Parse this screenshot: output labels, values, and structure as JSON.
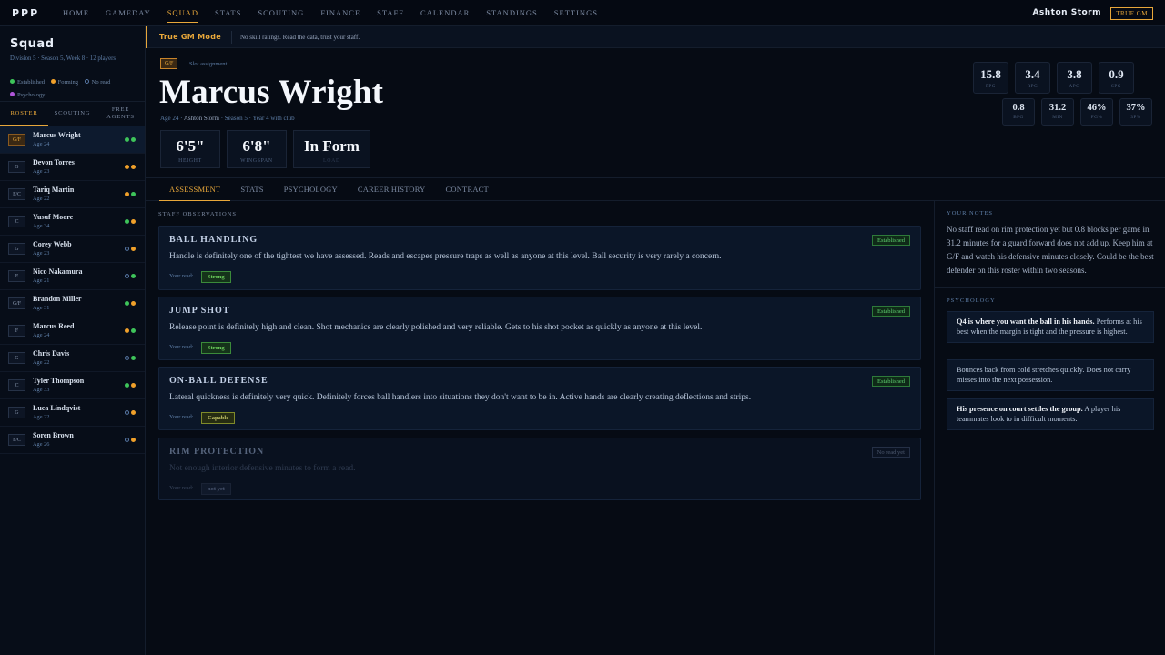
{
  "nav": {
    "logo": "PPP",
    "items": [
      "HOME",
      "GAMEDAY",
      "SQUAD",
      "STATS",
      "SCOUTING",
      "FINANCE",
      "STAFF",
      "CALENDAR",
      "STANDINGS",
      "SETTINGS"
    ],
    "active": "SQUAD",
    "user": "Ashton Storm",
    "mode_badge": "TRUE GM"
  },
  "sidebar": {
    "title": "Squad",
    "subtitle": "Division 5 · Season 5, Week 8 · 12 players",
    "legend": [
      "Established",
      "Forming",
      "No read",
      "Psychology"
    ],
    "tabs": [
      "ROSTER",
      "SCOUTING",
      "FREE AGENTS"
    ],
    "players": [
      {
        "pos": "G/F",
        "name": "Marcus Wright",
        "age": "Age 24",
        "dots": [
          "green",
          "green"
        ]
      },
      {
        "pos": "G",
        "name": "Devon Torres",
        "age": "Age 23",
        "dots": [
          "orange",
          "orange"
        ]
      },
      {
        "pos": "F/C",
        "name": "Tariq Martin",
        "age": "Age 22",
        "dots": [
          "orange",
          "green"
        ]
      },
      {
        "pos": "C",
        "name": "Yusuf Moore",
        "age": "Age 34",
        "dots": [
          "green",
          "orange"
        ]
      },
      {
        "pos": "G",
        "name": "Corey Webb",
        "age": "Age 23",
        "dots": [
          "empty",
          "orange"
        ]
      },
      {
        "pos": "F",
        "name": "Nico Nakamura",
        "age": "Age 21",
        "dots": [
          "empty",
          "green"
        ]
      },
      {
        "pos": "G/F",
        "name": "Brandon Miller",
        "age": "Age 31",
        "dots": [
          "green",
          "orange"
        ]
      },
      {
        "pos": "F",
        "name": "Marcus Reed",
        "age": "Age 24",
        "dots": [
          "orange",
          "green"
        ]
      },
      {
        "pos": "G",
        "name": "Chris Davis",
        "age": "Age 22",
        "dots": [
          "empty",
          "green"
        ]
      },
      {
        "pos": "C",
        "name": "Tyler Thompson",
        "age": "Age 33",
        "dots": [
          "green",
          "orange"
        ]
      },
      {
        "pos": "G",
        "name": "Luca Lindqvist",
        "age": "Age 22",
        "dots": [
          "empty",
          "orange"
        ]
      },
      {
        "pos": "F/C",
        "name": "Soren Brown",
        "age": "Age 26",
        "dots": [
          "empty",
          "orange"
        ]
      }
    ]
  },
  "banner": {
    "title": "True GM Mode",
    "text": "No skill ratings. Read the data, trust your staff."
  },
  "player": {
    "slot": "G/F",
    "slot_label": "Slot assignment",
    "name": "Marcus Wright",
    "meta_age": "Age 24 · ",
    "meta_coach": "Ashton Storm",
    "meta_rest": " · Season 5 · Year 4 with club",
    "bigstats": [
      {
        "value": "6'5\"",
        "label": "HEIGHT"
      },
      {
        "value": "6'8\"",
        "label": "WINGSPAN"
      },
      {
        "value": "In Form",
        "label": "LOAD"
      }
    ],
    "stats_row1": [
      {
        "value": "15.8",
        "label": "PPG"
      },
      {
        "value": "3.4",
        "label": "RPG"
      },
      {
        "value": "3.8",
        "label": "APG"
      },
      {
        "value": "0.9",
        "label": "SPG"
      }
    ],
    "stats_row2": [
      {
        "value": "0.8",
        "label": "BPG"
      },
      {
        "value": "31.2",
        "label": "MIN"
      },
      {
        "value": "46%",
        "label": "FG%"
      },
      {
        "value": "37%",
        "label": "3P%"
      }
    ]
  },
  "tabs": [
    "ASSESSMENT",
    "STATS",
    "PSYCHOLOGY",
    "CAREER HISTORY",
    "CONTRACT"
  ],
  "observations": {
    "heading": "STAFF OBSERVATIONS",
    "read_label": "Your read:",
    "items": [
      {
        "title": "BALL HANDLING",
        "status": "Established",
        "text": "Handle is definitely one of the tightest we have assessed. Reads and escapes pressure traps as well as anyone at this level. Ball security is very rarely a concern.",
        "read": "Strong"
      },
      {
        "title": "JUMP SHOT",
        "status": "Established",
        "text": "Release point is definitely high and clean. Shot mechanics are clearly polished and very reliable. Gets to his shot pocket as quickly as anyone at this level.",
        "read": "Strong"
      },
      {
        "title": "ON-BALL DEFENSE",
        "status": "Established",
        "text": "Lateral quickness is definitely very quick. Definitely forces ball handlers into situations they don't want to be in. Active hands are clearly creating deflections and strips.",
        "read": "Capable"
      },
      {
        "title": "RIM PROTECTION",
        "status": "No read yet",
        "text": "Not enough interior defensive minutes to form a read.",
        "read": "not yet"
      }
    ]
  },
  "notes": {
    "heading": "YOUR NOTES",
    "text": "No staff read on rim protection yet but 0.8 blocks per game in 31.2 minutes for a guard forward does not add up. Keep him at G/F and watch his defensive minutes closely. Could be the best defender on this roster within two seasons."
  },
  "psychology": {
    "heading": "PSYCHOLOGY",
    "cards": [
      {
        "bold": "Q4 is where you want the ball in his hands.",
        "text": " Performs at his best when the margin is tight and the pressure is highest."
      },
      {
        "bold": "",
        "text": "Bounces back from cold stretches quickly. Does not carry misses into the next possession."
      },
      {
        "bold": "His presence on court settles the group.",
        "text": " A player his teammates look to in difficult moments."
      }
    ]
  }
}
